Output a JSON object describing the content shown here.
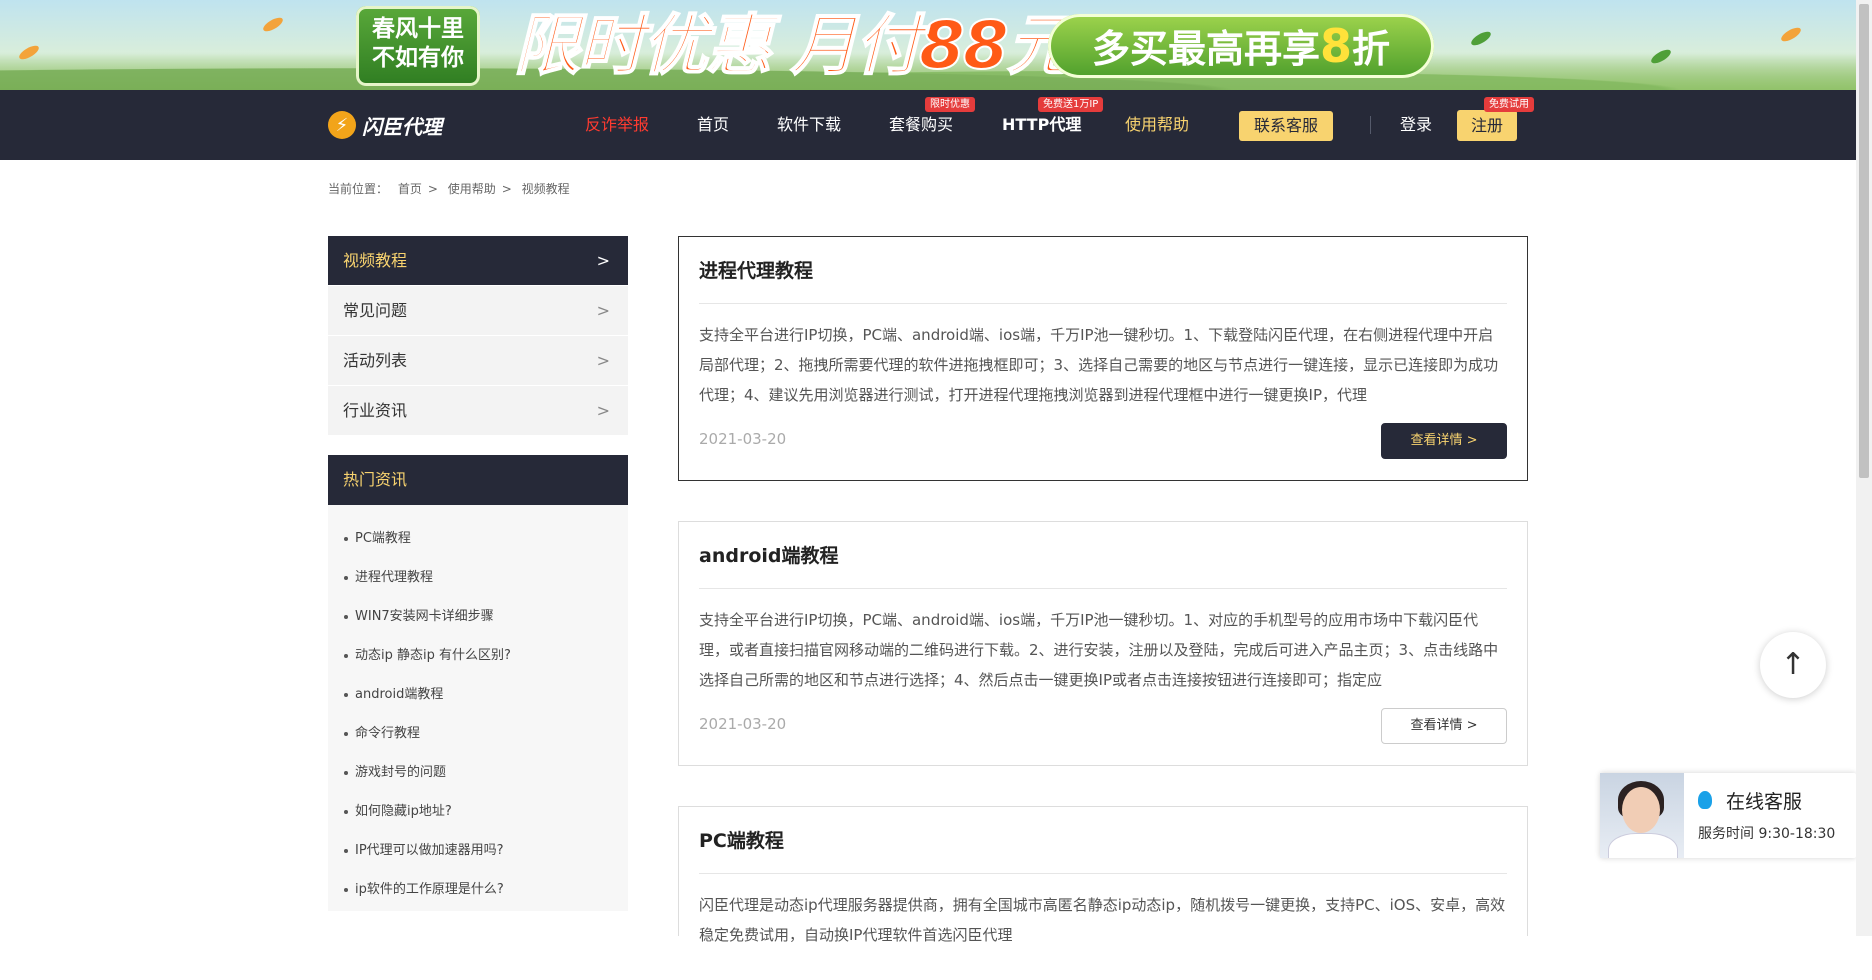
{
  "banner": {
    "tag_line1": "春风十里",
    "tag_line2": "不如有你",
    "promo_main": "限时优惠 月付88元",
    "promo_side_prefix": "多买最高再享",
    "promo_side_number": "8",
    "promo_side_suffix": "折"
  },
  "nav": {
    "logo_text": "闪臣代理",
    "logo_glyph": "⚡",
    "items": [
      {
        "label": "反诈举报",
        "color": "#ff3b30"
      },
      {
        "label": "首页"
      },
      {
        "label": "软件下载"
      },
      {
        "label": "套餐购买",
        "badge": "限时优惠"
      },
      {
        "label": "HTTP代理",
        "badge": "免费送1万IP"
      },
      {
        "label": "使用帮助",
        "color": "#f8d36f"
      }
    ],
    "contact_label": "联系客服",
    "login_label": "登录",
    "register_label": "注册",
    "register_badge": "免费试用"
  },
  "breadcrumb": {
    "prefix": "当前位置：",
    "items": [
      "首页",
      "使用帮助",
      "视频教程"
    ],
    "sep": ">"
  },
  "sidebar": {
    "menu": [
      {
        "label": "视频教程",
        "active": true
      },
      {
        "label": "常见问题"
      },
      {
        "label": "活动列表"
      },
      {
        "label": "行业资讯"
      }
    ],
    "chevron": ">",
    "hot_title": "热门资讯",
    "hot_items": [
      "PC端教程",
      "进程代理教程",
      "WIN7安装网卡详细步骤",
      "动态ip 静态ip 有什么区别?",
      "android端教程",
      "命令行教程",
      "游戏封号的问题",
      "如何隐藏ip地址?",
      "IP代理可以做加速器用吗?",
      "ip软件的工作原理是什么?"
    ]
  },
  "articles": [
    {
      "title": "进程代理教程",
      "body": "支持全平台进行IP切换，PC端、android端、ios端，千万IP池一键秒切。1、下载登陆闪臣代理，在右侧进程代理中开启局部代理；2、拖拽所需要代理的软件进拖拽框即可；3、选择自己需要的地区与节点进行一键连接，显示已连接即为成功代理；4、建议先用浏览器进行测试，打开进程代理拖拽浏览器到进程代理框中进行一键更换IP，代理",
      "date": "2021-03-20",
      "more": "查看详情 >"
    },
    {
      "title": "android端教程",
      "body": "支持全平台进行IP切换，PC端、android端、ios端，千万IP池一键秒切。1、对应的手机型号的应用市场中下载闪臣代理，或者直接扫描官网移动端的二维码进行下载。2、进行安装，注册以及登陆，完成后可进入产品主页；3、点击线路中选择自己所需的地区和节点进行选择；4、然后点击一键更换IP或者点击连接按钮进行连接即可；指定应",
      "date": "2021-03-20",
      "more": "查看详情 >"
    },
    {
      "title": "PC端教程",
      "body": "闪臣代理是动态ip代理服务器提供商，拥有全国城市高匿名静态ip动态ip，随机拨号一键更换，支持PC、iOS、安卓，高效稳定免费试用，自动换IP代理软件首选闪臣代理",
      "date": "",
      "more": ""
    }
  ],
  "floating": {
    "to_top_glyph": "↑",
    "cs_title": "在线客服",
    "cs_hours": "服务时间 9:30-18:30"
  }
}
